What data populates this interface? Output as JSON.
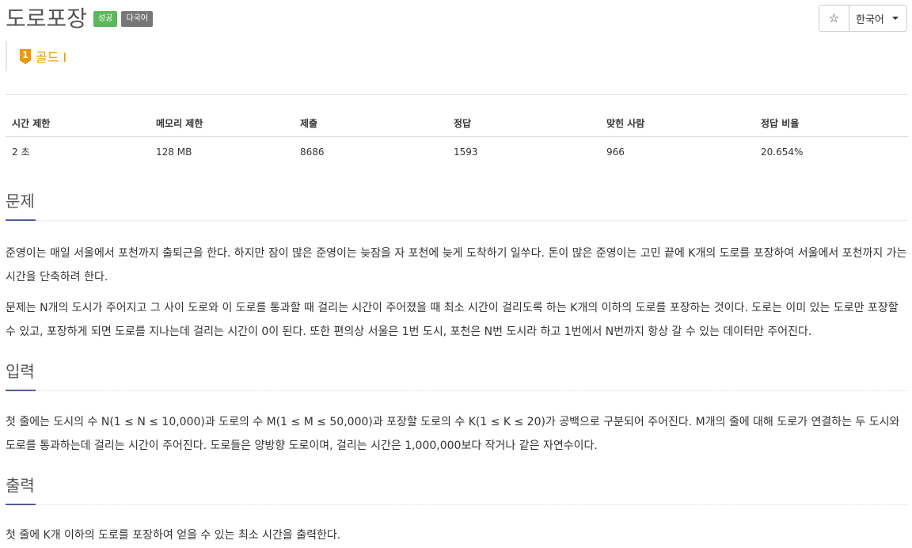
{
  "problem": {
    "title": "도로포장",
    "badges": {
      "success": "성공",
      "multilang": "다국어"
    },
    "tier": {
      "icon": "gold-tier-1-icon",
      "label": "골드 I",
      "color": "#ec9a00"
    }
  },
  "toolbar": {
    "star_icon": "star-outline-icon",
    "star_glyph": "☆",
    "language": "한국어"
  },
  "info_table": {
    "headers": [
      "시간 제한",
      "메모리 제한",
      "제출",
      "정답",
      "맞힌 사람",
      "정답 비율"
    ],
    "values": [
      "2 초",
      "128 MB",
      "8686",
      "1593",
      "966",
      "20.654%"
    ]
  },
  "sections": {
    "description": {
      "title": "문제",
      "paragraphs": [
        "준영이는 매일 서울에서 포천까지 출퇴근을 한다. 하지만 잠이 많은 준영이는 늦잠을 자 포천에 늦게 도착하기 일쑤다. 돈이 많은 준영이는 고민 끝에 K개의 도로를 포장하여 서울에서 포천까지 가는 시간을 단축하려 한다.",
        "문제는 N개의 도시가 주어지고 그 사이 도로와 이 도로를 통과할 때 걸리는 시간이 주어졌을 때 최소 시간이 걸리도록 하는 K개의 이하의 도로를 포장하는 것이다. 도로는 이미 있는 도로만 포장할 수 있고, 포장하게 되면 도로를 지나는데 걸리는 시간이 0이 된다. 또한 편의상 서울은 1번 도시, 포천은 N번 도시라 하고 1번에서 N번까지 항상 갈 수 있는 데이터만 주어진다."
      ]
    },
    "input": {
      "title": "입력",
      "paragraphs": [
        "첫 줄에는 도시의 수 N(1 ≤ N ≤ 10,000)과 도로의 수 M(1 ≤ M ≤ 50,000)과 포장할 도로의 수 K(1 ≤ K ≤ 20)가 공백으로 구분되어 주어진다. M개의 줄에 대해 도로가 연결하는 두 도시와 도로를 통과하는데 걸리는 시간이 주어진다. 도로들은 양방향 도로이며, 걸리는 시간은 1,000,000보다 작거나 같은 자연수이다."
      ]
    },
    "output": {
      "title": "출력",
      "paragraphs": [
        "첫 줄에 K개 이하의 도로를 포장하여 얻을 수 있는 최소 시간을 출력한다."
      ]
    }
  },
  "colors": {
    "success": "#5cb85c",
    "default": "#777777",
    "accent": "#4e5ca0",
    "tier": "#ec9a00"
  }
}
